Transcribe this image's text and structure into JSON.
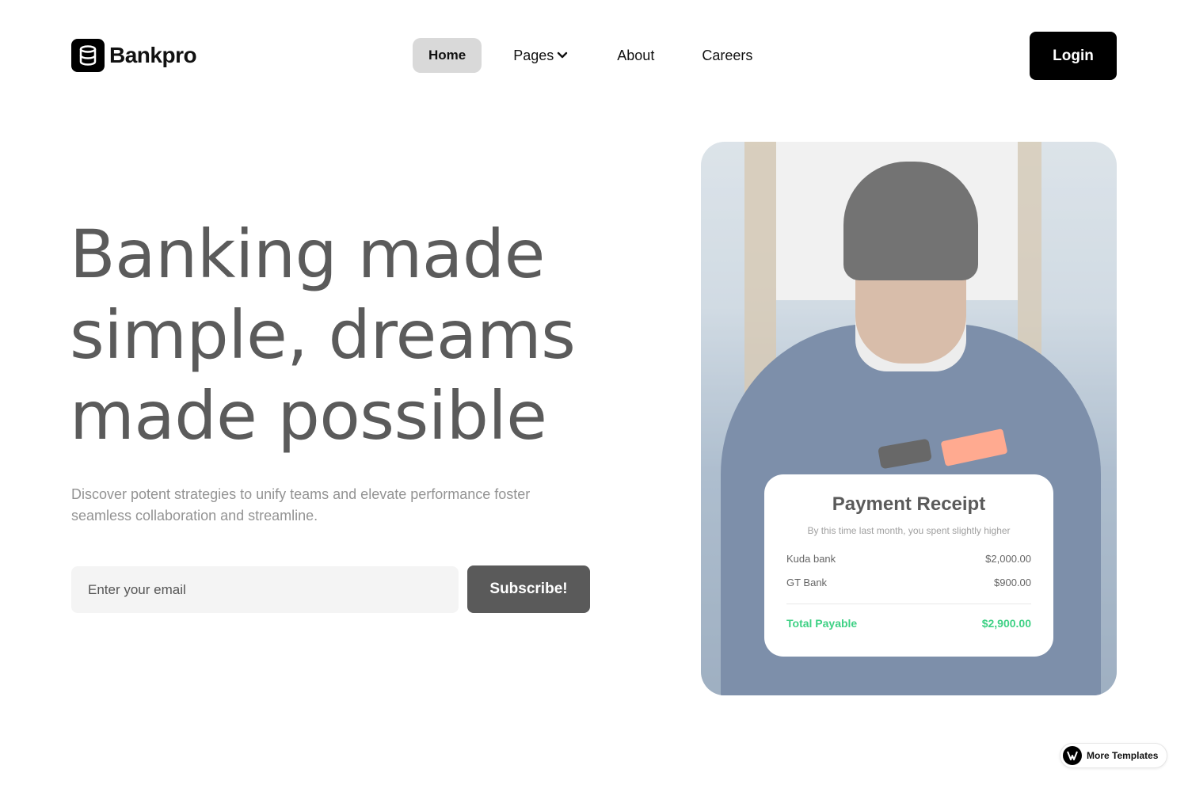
{
  "brand": {
    "name": "Bankpro",
    "logo_icon": "database-icon"
  },
  "nav": {
    "items": [
      {
        "label": "Home",
        "active": true
      },
      {
        "label": "Pages",
        "has_dropdown": true
      },
      {
        "label": "About"
      },
      {
        "label": "Careers"
      }
    ]
  },
  "header": {
    "login_label": "Login"
  },
  "hero": {
    "title_lines": [
      "Banking made",
      "simple, dreams",
      "made possible"
    ],
    "subtitle": "Discover potent strategies to unify teams and elevate performance foster seamless collaboration and streamline.",
    "email_placeholder": "Enter your email",
    "subscribe_label": "Subscribe!"
  },
  "receipt": {
    "title": "Payment Receipt",
    "subtitle": "By this time last month, you spent slightly higher",
    "rows": [
      {
        "label": "Kuda bank",
        "amount": "$2,000.00"
      },
      {
        "label": "GT Bank",
        "amount": "$900.00"
      }
    ],
    "total_label": "Total Payable",
    "total_amount": "$2,900.00",
    "total_color": "#3fd185"
  },
  "badge": {
    "label": "More Templates"
  },
  "colors": {
    "accent": "#000000",
    "subscribe": "#5a5a5a",
    "nav_active_bg": "#d9d9d9"
  }
}
